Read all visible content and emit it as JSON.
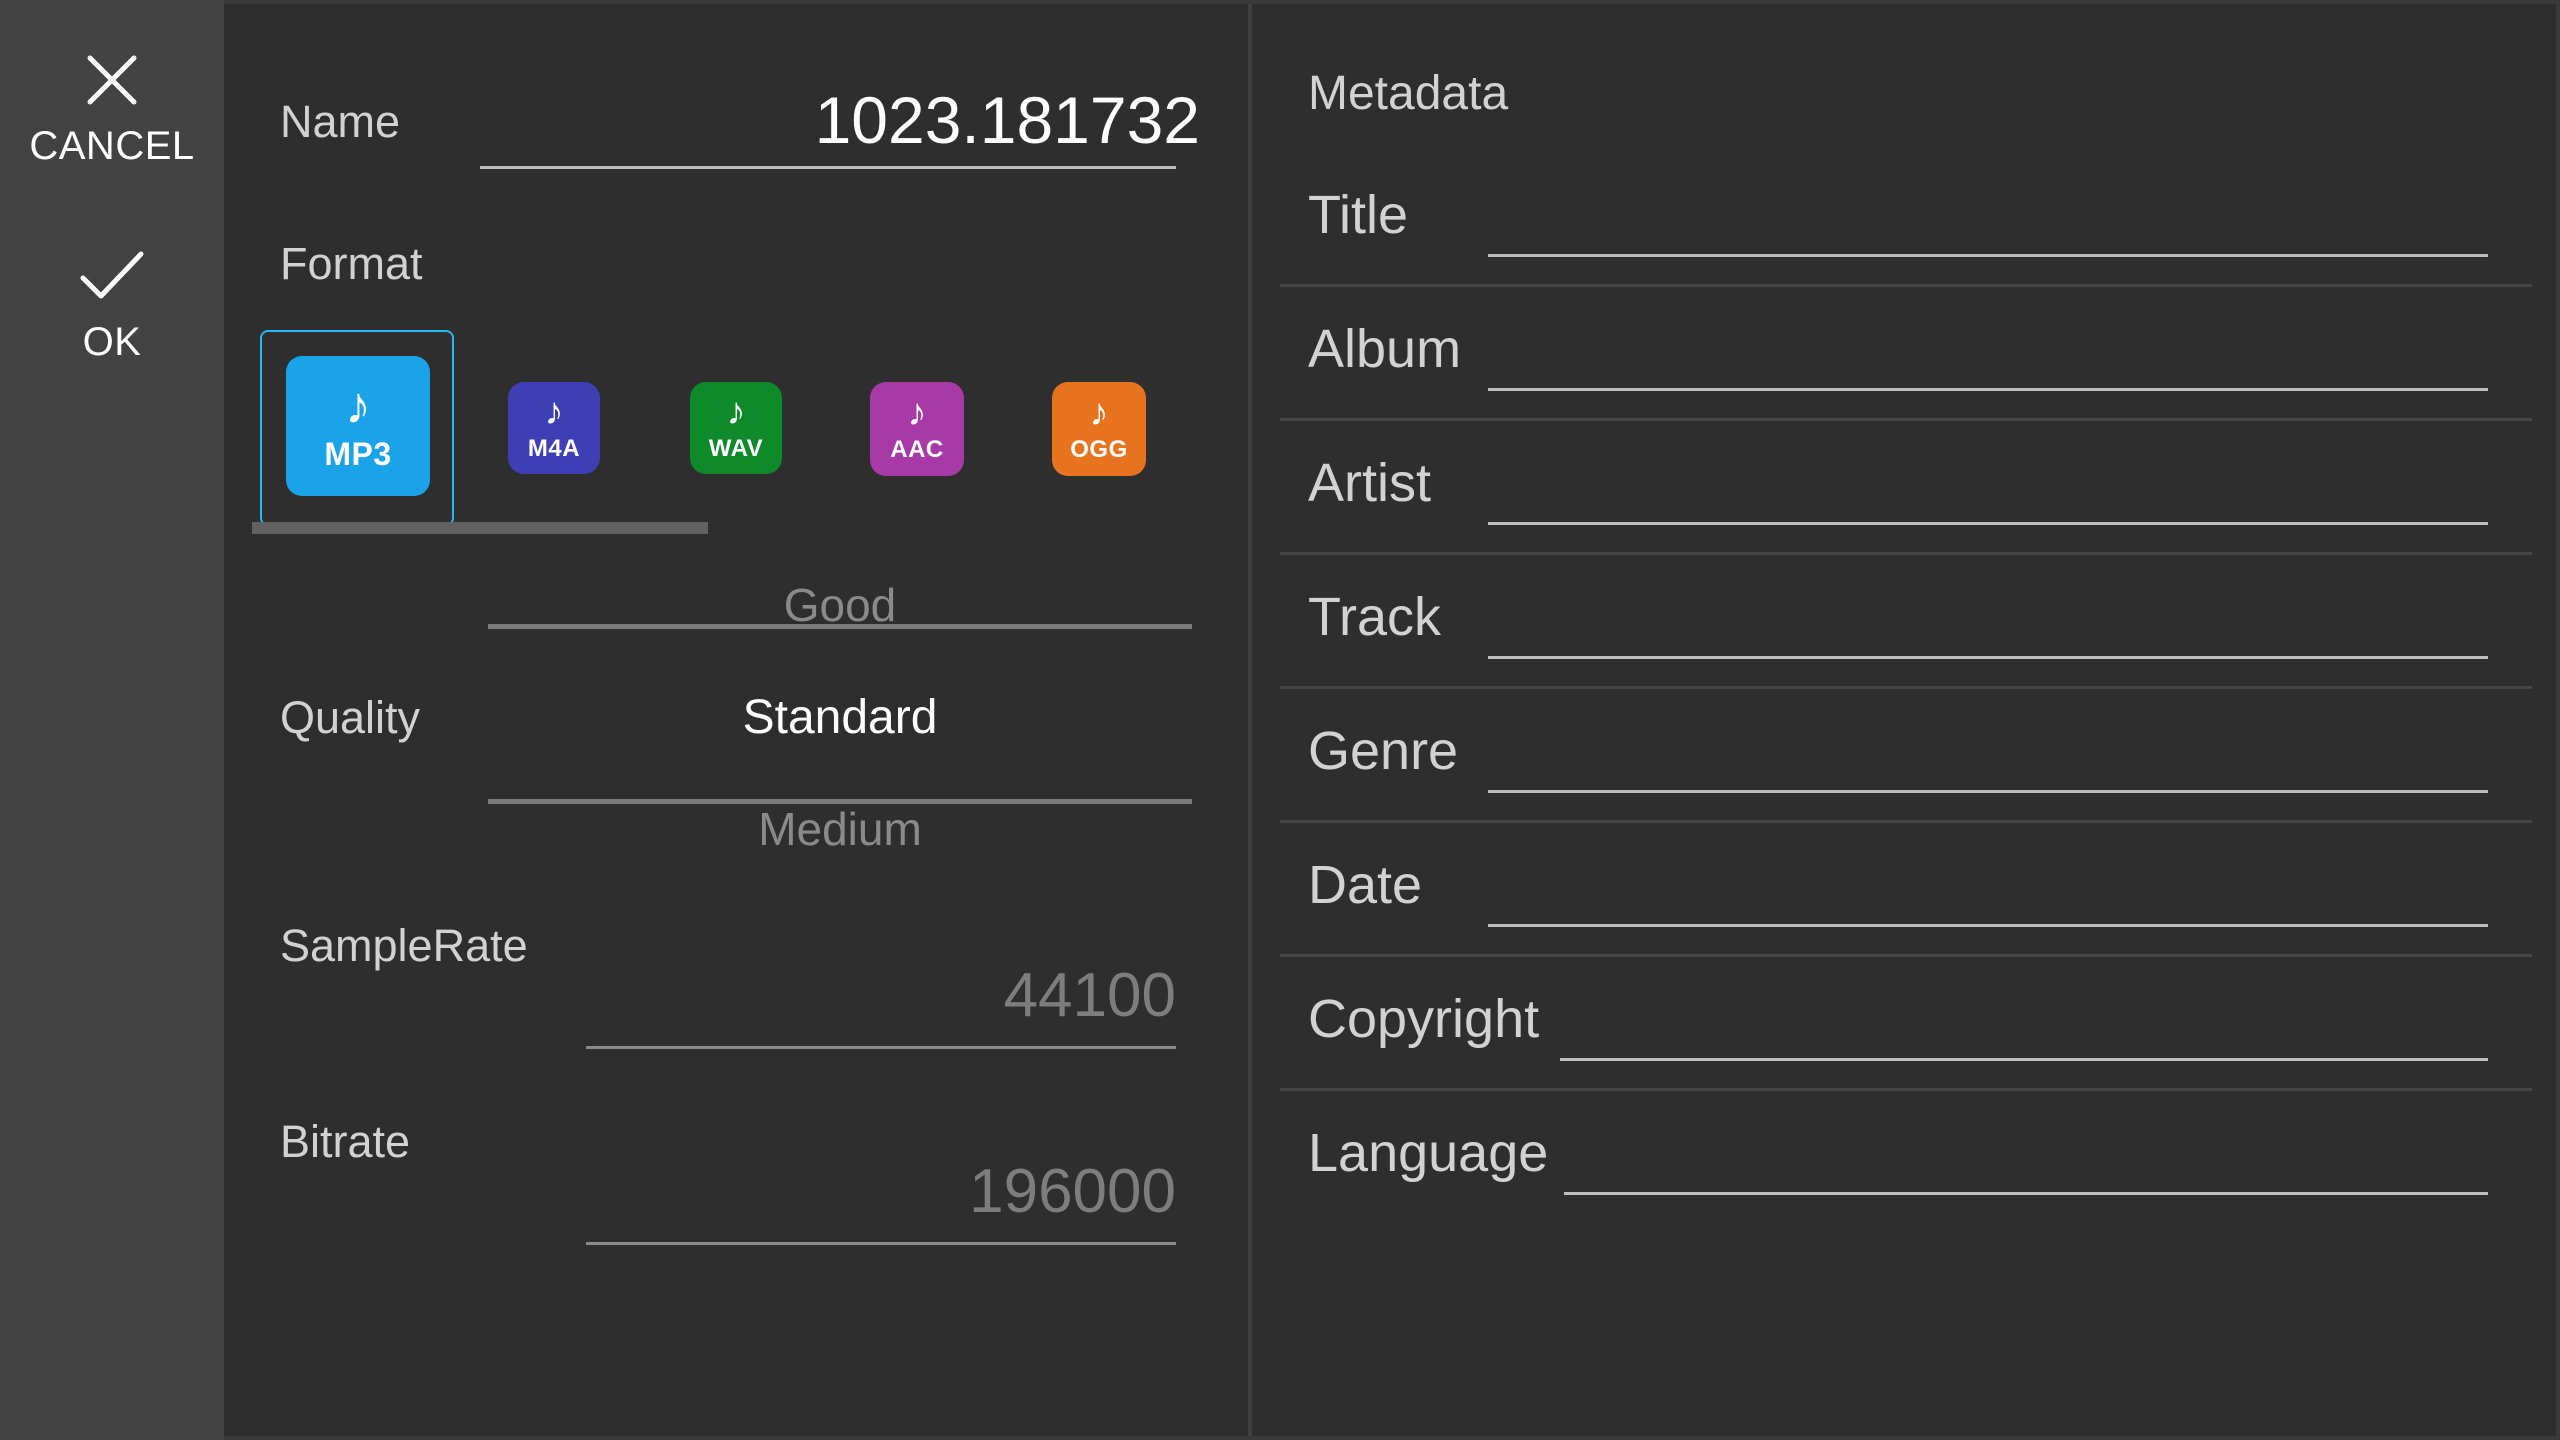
{
  "sidebar": {
    "cancel_label": "CANCEL",
    "ok_label": "OK"
  },
  "form": {
    "name_label": "Name",
    "name_value": "1023.181732",
    "format_label": "Format",
    "formats": [
      {
        "ext": "MP3",
        "color": "#1aa3e8",
        "selected": true
      },
      {
        "ext": "M4A",
        "color": "#3f3fb5"
      },
      {
        "ext": "WAV",
        "color": "#0f8a2a"
      },
      {
        "ext": "AAC",
        "color": "#a83aa8"
      },
      {
        "ext": "OGG",
        "color": "#e8731f"
      }
    ],
    "quality_label": "Quality",
    "quality_prev": "Good",
    "quality_current": "Standard",
    "quality_next": "Medium",
    "samplerate_label": "SampleRate",
    "samplerate_value": "44100",
    "bitrate_label": "Bitrate",
    "bitrate_value": "196000"
  },
  "metadata": {
    "title": "Metadata",
    "fields": [
      "Title",
      "Album",
      "Artist",
      "Track",
      "Genre",
      "Date",
      "Copyright",
      "Language"
    ]
  },
  "colors": {
    "accent": "#29b6f6",
    "background": "#2e2e2e",
    "sidebar": "#424242"
  }
}
